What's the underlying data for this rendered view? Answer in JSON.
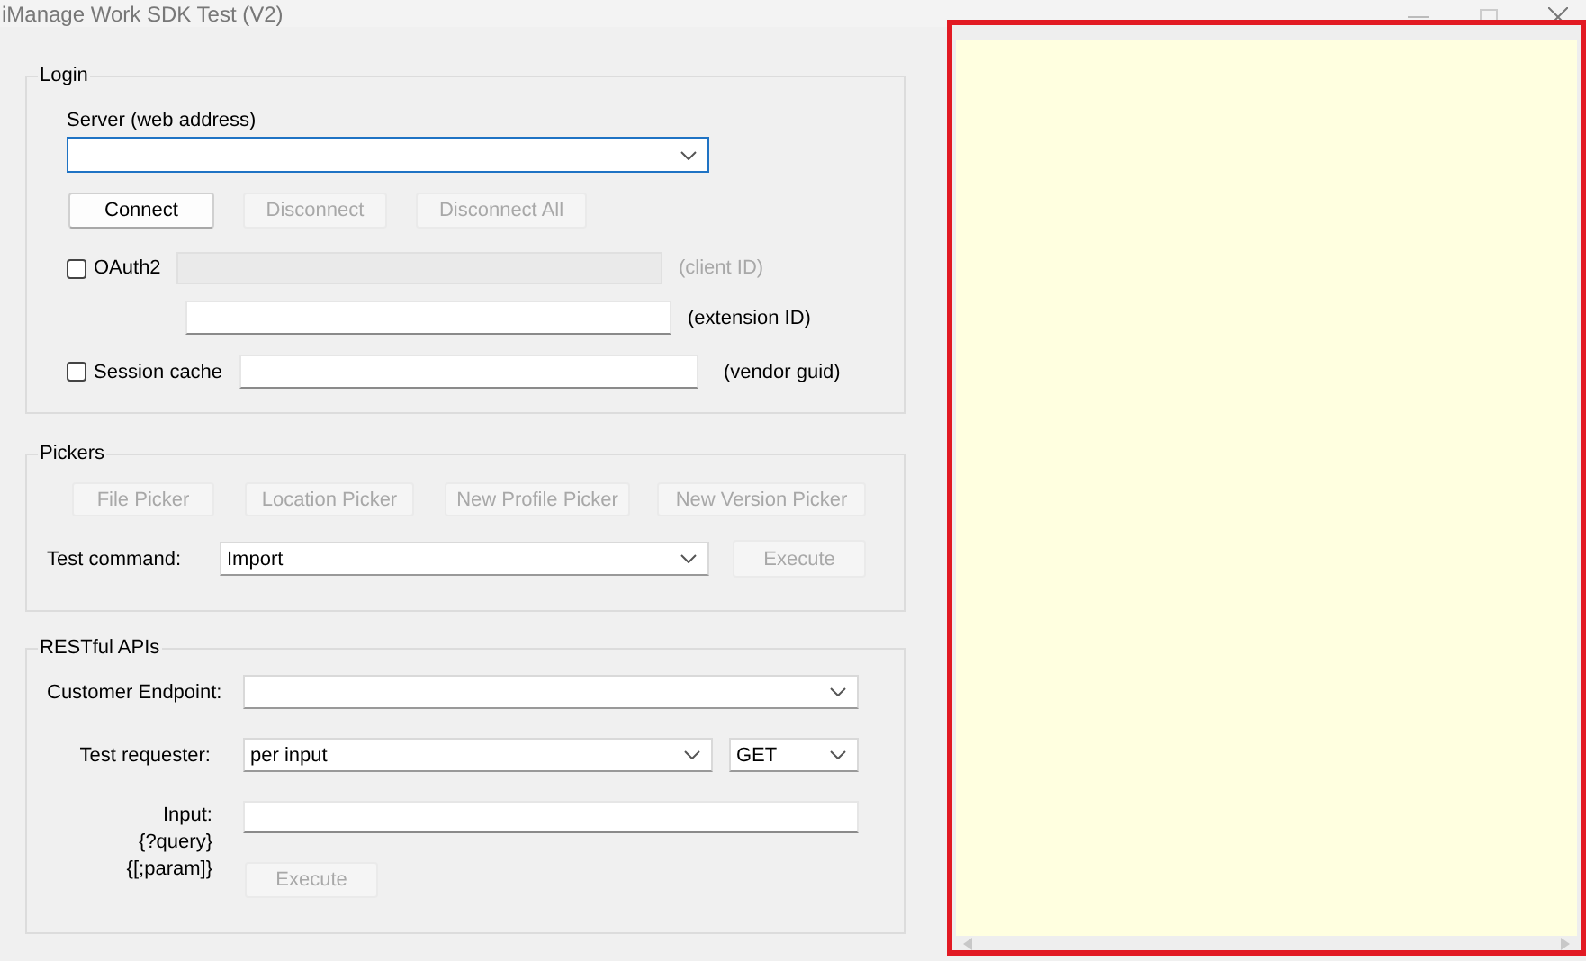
{
  "window": {
    "title": "iManage Work SDK Test (V2)"
  },
  "login": {
    "title": "Login",
    "server_label": "Server (web address)",
    "buttons": [
      {
        "label": "Connect",
        "disabled": false
      },
      {
        "label": "Disconnect",
        "disabled": true
      },
      {
        "label": "Disconnect All",
        "disabled": true
      }
    ],
    "oauth": {
      "label": "OAuth2",
      "checked": false,
      "client_id_label": "(client ID)",
      "client_id_disabled": true,
      "extension_label": "(extension ID)"
    },
    "session": {
      "label": "Session cache",
      "checked": false,
      "vendor_label": "(vendor guid)"
    }
  },
  "pickers": {
    "title": "Pickers",
    "buttons": [
      {
        "label": "File Picker",
        "disabled": true
      },
      {
        "label": "Location Picker",
        "disabled": true
      },
      {
        "label": "New Profile Picker",
        "disabled": true
      },
      {
        "label": "New Version Picker",
        "disabled": true
      }
    ],
    "test_command_label": "Test command:",
    "test_command_value": "Import",
    "execute": {
      "label": "Execute",
      "disabled": true
    }
  },
  "restful": {
    "title": "RESTful APIs",
    "endpoint_label": "Customer Endpoint:",
    "requester_label": "Test requester:",
    "requester_value": "per input",
    "method_value": "GET",
    "input_label_lines": [
      "Input:",
      "{?query}",
      "{[;param]}"
    ],
    "execute": {
      "label": "Execute",
      "disabled": true
    }
  }
}
